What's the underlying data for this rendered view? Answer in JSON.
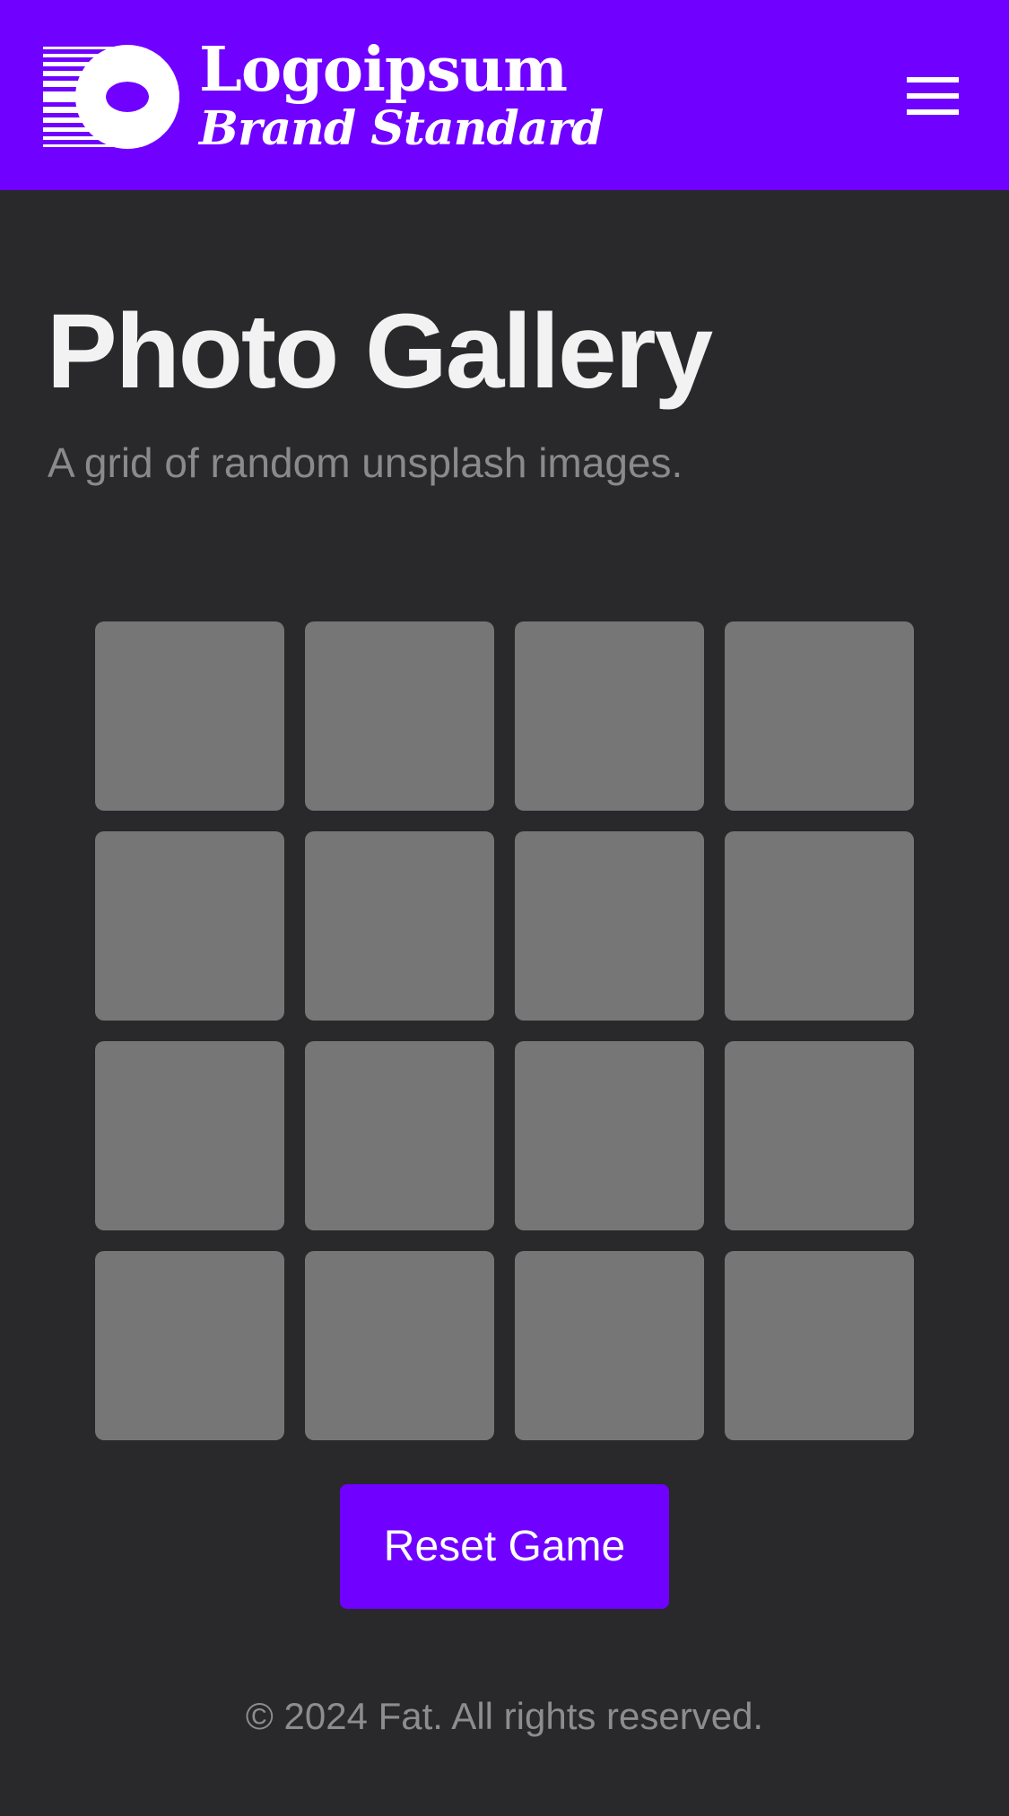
{
  "header": {
    "brand_name": "Logoipsum",
    "brand_tagline": "Brand Standard",
    "logo_icon": "striped-circle-logo-icon",
    "menu_icon": "hamburger-menu-icon",
    "background_color": "#7000ff"
  },
  "main": {
    "title": "Photo Gallery",
    "subtitle": "A grid of random unsplash images.",
    "gallery": {
      "rows": 4,
      "columns": 4,
      "tile_color": "#767676"
    },
    "reset_label": "Reset Game"
  },
  "footer": {
    "text": "© 2024 Fat. All rights reserved."
  },
  "colors": {
    "page_background": "#29282b",
    "accent": "#7000ff",
    "title_text": "#f2f2f2",
    "muted_text": "#8a8a8c"
  }
}
